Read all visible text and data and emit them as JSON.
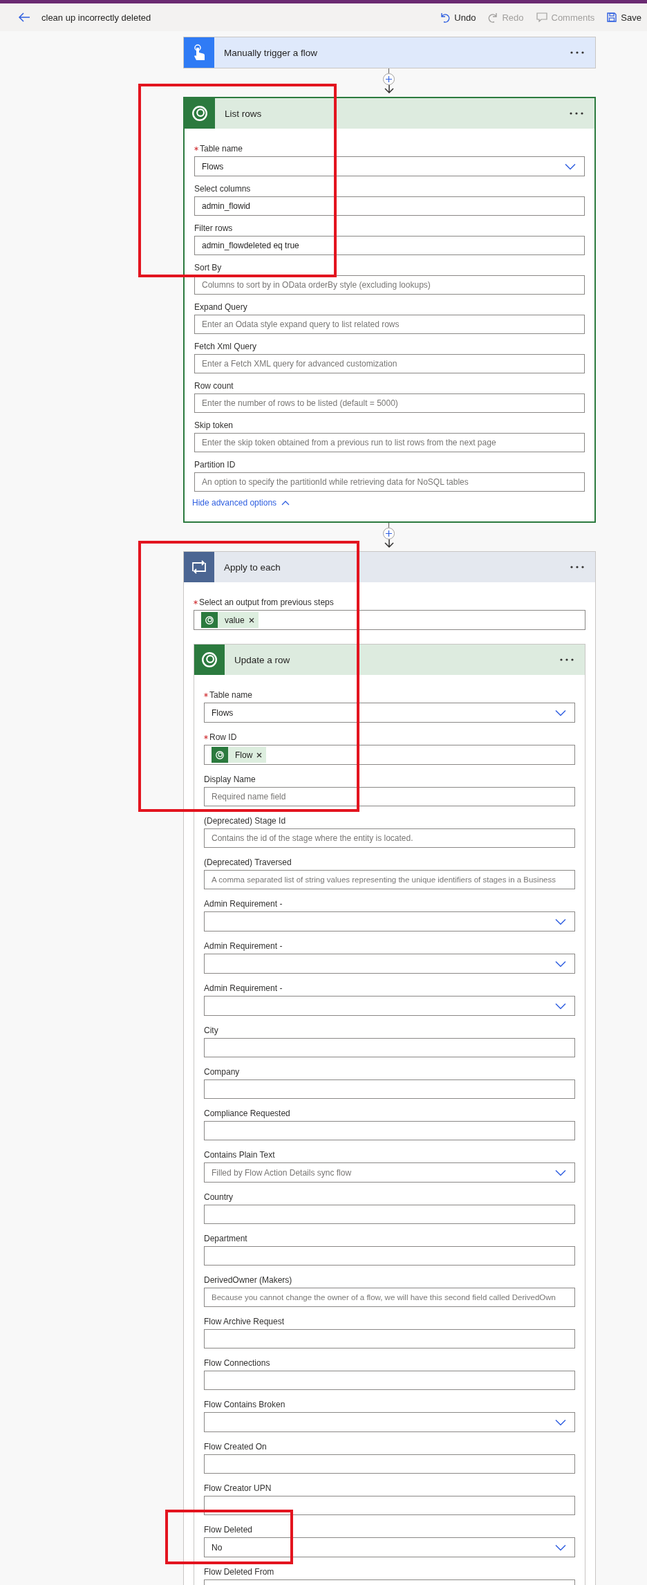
{
  "header": {
    "title": "clean up incorrectly deleted",
    "actions": [
      {
        "label": "Undo",
        "disabled": false
      },
      {
        "label": "Redo",
        "disabled": true
      },
      {
        "label": "Comments",
        "disabled": true
      },
      {
        "label": "Save",
        "disabled": false
      }
    ]
  },
  "steps": [
    {
      "kind": "trigger",
      "title": "Manually trigger a flow",
      "highlighted": false
    },
    {
      "kind": "dataverse",
      "title": "List rows",
      "highlighted": true,
      "fields": [
        {
          "kind": "dropdown",
          "label": "Table name",
          "required": true,
          "value": "Flows"
        },
        {
          "kind": "text",
          "label": "Select columns",
          "required": false,
          "value": "admin_flowid"
        },
        {
          "kind": "text",
          "label": "Filter rows",
          "required": false,
          "value": "admin_flowdeleted eq true"
        },
        {
          "kind": "text",
          "label": "Sort By",
          "required": false,
          "placeholder": "Columns to sort by in OData orderBy style (excluding lookups)"
        },
        {
          "kind": "text",
          "label": "Expand Query",
          "required": false,
          "placeholder": "Enter an Odata style expand query to list related rows"
        },
        {
          "kind": "text",
          "label": "Fetch Xml Query",
          "required": false,
          "placeholder": "Enter a Fetch XML query for advanced customization"
        },
        {
          "kind": "text",
          "label": "Row count",
          "required": false,
          "placeholder": "Enter the number of rows to be listed (default = 5000)"
        },
        {
          "kind": "text",
          "label": "Skip token",
          "required": false,
          "placeholder": "Enter the skip token obtained from a previous run to list rows from the next page"
        },
        {
          "kind": "text",
          "label": "Partition ID",
          "required": false,
          "placeholder": "An option to specify the partitionId while retrieving data for NoSQL tables"
        }
      ],
      "link": "Hide advanced options"
    },
    {
      "kind": "loop",
      "title": "Apply to each",
      "highlighted": true,
      "fields": [
        {
          "kind": "token",
          "label": "Select an output from previous steps",
          "required": true,
          "tokens": [
            "value"
          ]
        }
      ],
      "actions": [
        {
          "kind": "dataverse",
          "title": "Update a row",
          "highlighted": false,
          "fields": [
            {
              "kind": "dropdown",
              "label": "Table name",
              "required": true,
              "value": "Flows"
            },
            {
              "kind": "token",
              "label": "Row ID",
              "required": true,
              "tokens": [
                "Flow"
              ]
            },
            {
              "kind": "text",
              "label": "Display Name",
              "required": false,
              "placeholder": "Required name field"
            },
            {
              "kind": "text",
              "label": "(Deprecated) Stage Id",
              "required": false,
              "placeholder": "Contains the id of the stage where the entity is located."
            },
            {
              "kind": "text",
              "label": "(Deprecated) Traversed",
              "required": false,
              "placeholder": "A comma separated list of string values representing the unique identifiers of stages in a Business"
            },
            {
              "kind": "dropdown",
              "label": "Admin Requirement -",
              "required": false
            },
            {
              "kind": "dropdown",
              "label": "Admin Requirement -",
              "required": false
            },
            {
              "kind": "dropdown",
              "label": "Admin Requirement -",
              "required": false
            },
            {
              "kind": "text",
              "label": "City",
              "required": false
            },
            {
              "kind": "text",
              "label": "Company",
              "required": false
            },
            {
              "kind": "text",
              "label": "Compliance Requested",
              "required": false
            },
            {
              "kind": "dropdown",
              "label": "Contains Plain Text",
              "required": false,
              "placeholder": "Filled by Flow Action Details sync flow"
            },
            {
              "kind": "text",
              "label": "Country",
              "required": false
            },
            {
              "kind": "text",
              "label": "Department",
              "required": false
            },
            {
              "kind": "text",
              "label": "DerivedOwner (Makers)",
              "required": false,
              "placeholder": "Because you cannot change the owner of a flow, we will have this second field called DerivedOwn"
            },
            {
              "kind": "text",
              "label": "Flow Archive Request",
              "required": false
            },
            {
              "kind": "text",
              "label": "Flow Connections",
              "required": false
            },
            {
              "kind": "dropdown",
              "label": "Flow Contains Broken",
              "required": false
            },
            {
              "kind": "text",
              "label": "Flow Created On",
              "required": false
            },
            {
              "kind": "text",
              "label": "Flow Creator UPN",
              "required": false
            },
            {
              "kind": "dropdown",
              "label": "Flow Deleted",
              "required": false,
              "value": "No",
              "highlighted": true
            },
            {
              "kind": "text",
              "label": "Flow Deleted From",
              "required": false
            }
          ]
        }
      ]
    }
  ]
}
